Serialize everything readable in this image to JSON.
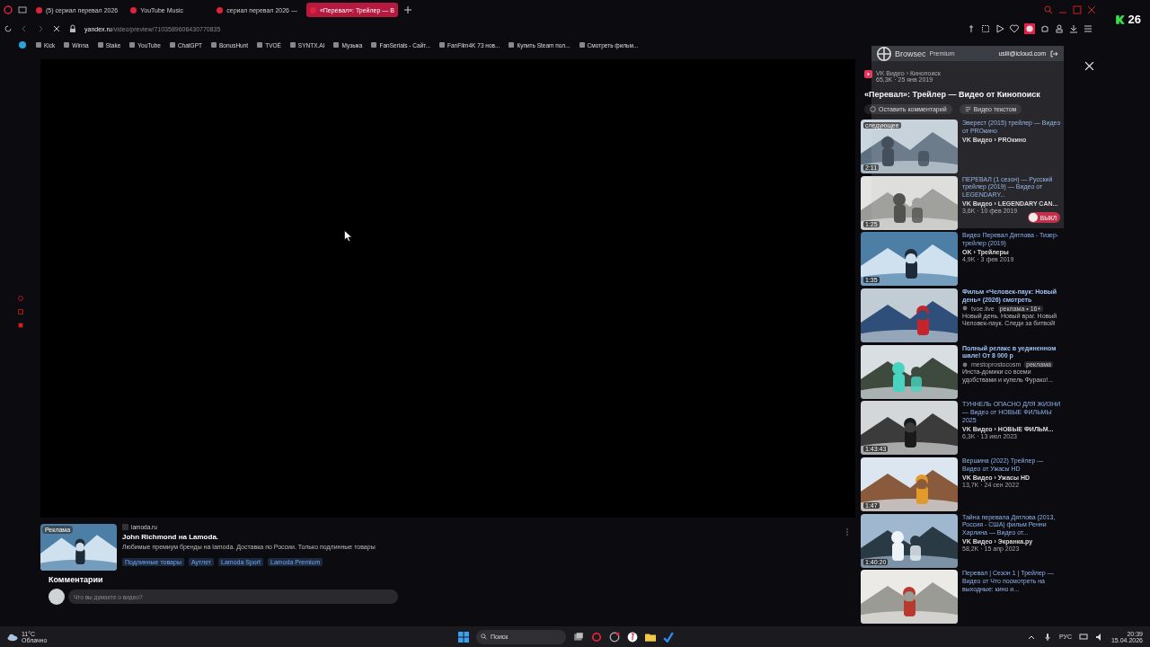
{
  "browser": {
    "tabs": [
      {
        "title": "(5) сериал перевал 2026",
        "selected": false
      },
      {
        "title": "YouTube Music",
        "selected": false
      },
      {
        "title": "сериал перевал 2026 —",
        "selected": false
      },
      {
        "title": "«Перевал»: Трейлер — В",
        "selected": true
      }
    ],
    "address": {
      "domain": "yandex.ru",
      "path": "/video/preview/7103589606430770835"
    },
    "bookmarks": [
      "Kick",
      "Winna",
      "Stake",
      "YouTube",
      "ChatGPT",
      "BonusHunt",
      "TVOЁ",
      "SYNTX.AI",
      "Музыка",
      "FanSerials - Сайт...",
      "FanFilm4K 73 нов...",
      "Купить Steam пол...",
      "Смотреть фильм..."
    ]
  },
  "overlay_badge": {
    "count": "26"
  },
  "video": {
    "channel": "VK Видео › Кинопоиск",
    "meta": "65,3K · 25 янв 2019",
    "title": "«Перевал»: Трейлер — Видео от Кинопоиск",
    "actions": [
      "Оставить комментарий",
      "Видео текстом"
    ]
  },
  "recommendations": [
    {
      "kind": "video",
      "title": "Эверест (2015) трейлер — Видео от PROкино",
      "source": "VK Видео › PROкино",
      "badge": "следующее",
      "duration": "2:11"
    },
    {
      "kind": "video",
      "title": "ПЕРЕВАЛ (1 сезон) — Русский трейлер (2019) — Видео от LEGENDARY...",
      "source": "VK Видео › LEGENDARY CAN...",
      "meta": "3,6K · 10 фев 2019",
      "duration": "1:25"
    },
    {
      "kind": "video",
      "title": "Видео Перевал Дятлова - Тизер-трейлер (2019)",
      "source": "OK › Трейлеры",
      "meta": "4,9K · 3 фев 2019",
      "duration": "1:35"
    },
    {
      "kind": "ad",
      "title": "Фильм «Человек-паук: Новый день» (2026) смотреть",
      "source": "tvoe.live",
      "ad_label": "реклама • 16+",
      "description": "Новый день. Новый враг. Новый Человек-паук. Следи за битвой!"
    },
    {
      "kind": "ad",
      "title": "Полный релакс в уединенном шале! От 8 000 р",
      "source": "mestoprostocosm",
      "ad_label": "реклама",
      "description": "Инста-домики со всеми удобствами и купель Фурако!..."
    },
    {
      "kind": "video",
      "title": "ТУННЕЛЬ ОПАСНО ДЛЯ ЖИЗНИ — Видео от НОВЫЕ ФИЛЬМЫ 2025",
      "source": "VK Видео › НОВЫЕ ФИЛЬМ...",
      "meta": "6,3K · 13 июл 2023",
      "duration": "1:43:43"
    },
    {
      "kind": "video",
      "title": "Вершина (2022) Трейлер — Видео от Ужасы HD",
      "source": "VK Видео › Ужасы HD",
      "meta": "13,7K · 24 сен 2022",
      "duration": "1:47"
    },
    {
      "kind": "video",
      "title": "Тайна перевала Дятлова (2013, Россия - США) фильм Ренни Харлина — Видео от...",
      "source": "VK Видео › Экранка.ру",
      "meta": "58,2K · 15 апр 2023",
      "duration": "1:40:20"
    },
    {
      "kind": "video",
      "title": "Перевал | Сезон 1 | Трейлер — Видео от Что посмотреть на выходные: кино и..."
    }
  ],
  "ad": {
    "badge": "Реклама",
    "domain": "lamoda.ru",
    "title": "John Richmond на Lamoda.",
    "text": "Любимые премиум бренды на lamoda. Доставка по России. Только подлинные товары",
    "links": [
      "Подлинные товары",
      "Аутлет",
      "Lamoda Sport",
      "Lamoda Premium"
    ]
  },
  "comments": {
    "heading": "Комментарии",
    "placeholder": "Что вы думаете о видео?"
  },
  "extension_popup": {
    "name": "Browsec",
    "plan": "Premium",
    "email": "usiii@icloud.com",
    "toggle_label": "ВЫКЛ",
    "on": false
  },
  "taskbar": {
    "temperature": "11°C",
    "weather": "Облачно",
    "search_placeholder": "Поиск",
    "language": "РУС",
    "time": "20:39",
    "date": "15.04.2026"
  }
}
